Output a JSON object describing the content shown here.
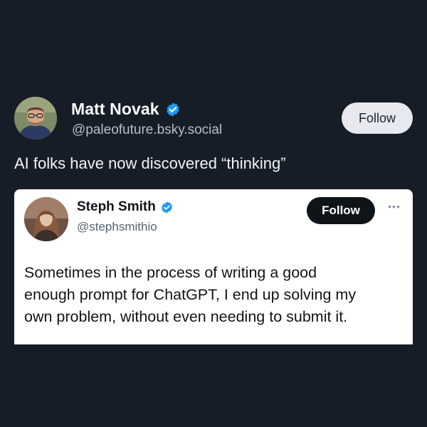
{
  "post": {
    "author": {
      "name": "Matt Novak",
      "handle": "@paleofuture.bsky.social",
      "verified": true,
      "follow_label": "Follow"
    },
    "text": "AI folks have now discovered “thinking”"
  },
  "quoted_post": {
    "author": {
      "name": "Steph Smith",
      "handle": "@stephsmithio",
      "verified": true,
      "follow_label": "Follow",
      "more_icon": "more-horizontal-icon"
    },
    "text_lines": [
      "Sometimes in the process of writing a good",
      "enough prompt for ChatGPT, I end up solving my",
      "own problem, without even needing to submit it."
    ]
  },
  "colors": {
    "background": "#161d27",
    "verified_blue": "#1d9bf0",
    "outer_follow_bg": "#e7e9ee",
    "card_follow_bg": "#0f1419"
  }
}
